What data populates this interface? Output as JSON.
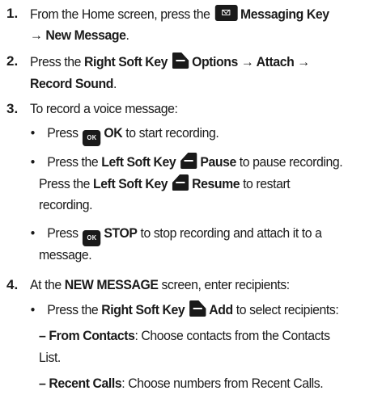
{
  "steps": [
    {
      "number": "1.",
      "line1_pre": "From the Home screen, press the ",
      "line1_key_icon": "messaging-key-icon",
      "line1_bold": "Messaging Key",
      "line2_bold": "→ New Message",
      "line2_post": "."
    },
    {
      "number": "2.",
      "line1_pre": "Press the ",
      "line1_bold1": "Right Soft Key",
      "line1_key_icon": "right-soft-key-icon",
      "line1_bold2": "Options → Attach →",
      "line2_bold": "Record Sound",
      "line2_post": "."
    },
    {
      "number": "3.",
      "line1": "To record a voice message:",
      "bullets": [
        {
          "pre": "Press ",
          "key_icon": "ok-key-icon",
          "bold": "OK",
          "post": " to start recording."
        },
        {
          "l1_pre": "Press the ",
          "l1_bold1": "Left Soft Key",
          "l1_key_icon": "left-soft-key-icon",
          "l1_bold2": "Pause",
          "l1_post": " to pause recording.",
          "l2_pre": "Press the ",
          "l2_bold1": "Left Soft Key",
          "l2_bold2": "Resume",
          "l2_post": " to restart",
          "l3": "recording."
        },
        {
          "l1_pre": "Press ",
          "l1_key_icon": "ok-key-icon",
          "l1_bold": "STOP",
          "l1_post": " to stop recording and attach it to a",
          "l2": "message."
        }
      ]
    },
    {
      "number": "4.",
      "line1_pre": "At the ",
      "line1_bold": "NEW MESSAGE",
      "line1_post": " screen, enter recipients:",
      "bullet": {
        "pre": "Press the ",
        "bold1": "Right Soft Key",
        "key_icon": "right-soft-key-icon",
        "bold2": "Add",
        "post": " to select recipients:"
      },
      "dashes": [
        {
          "dash": "–",
          "bold": "From Contacts",
          "l1_post": ": Choose contacts from the Contacts",
          "l2": "List."
        },
        {
          "dash": "–",
          "bold": "Recent Calls",
          "l1_post": ": Choose numbers from Recent Calls."
        }
      ]
    }
  ],
  "key_labels": {
    "ok": "OK"
  },
  "colors": {
    "text": "#1a1a1a",
    "key_bg": "#1a1a1a",
    "key_fg": "#ffffff"
  }
}
